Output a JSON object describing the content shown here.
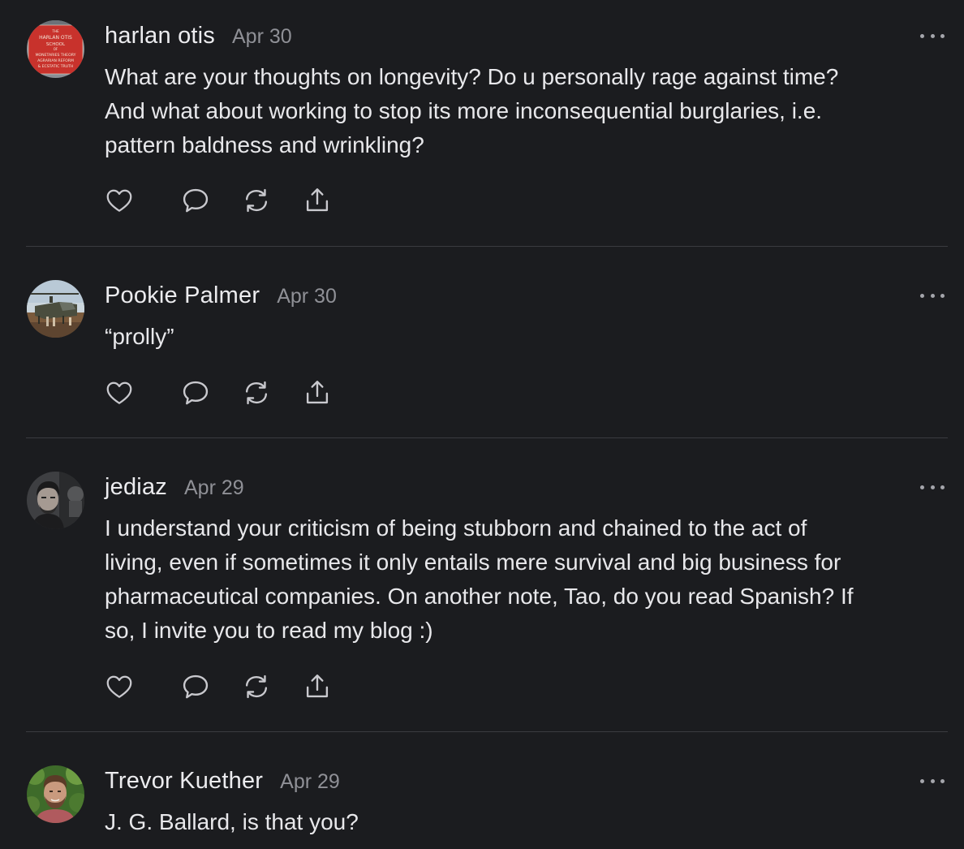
{
  "comments": [
    {
      "author": "harlan otis",
      "date": "Apr 30",
      "body_lines": [
        "What are your thoughts on longevity? Do u personally rage against time?",
        "And what about working to stop its more inconsequential burglaries, i.e.",
        "pattern baldness and wrinkling?"
      ],
      "avatar_sign_text": [
        "THE",
        "HARLAN OTIS",
        "SCHOOL",
        "OF",
        "MONETARIES THEORY",
        "AGRARIAN REFORM",
        "& ECSTATIC TRUTH"
      ]
    },
    {
      "author": "Pookie Palmer",
      "date": "Apr 30",
      "body_lines": [
        "“prolly”"
      ]
    },
    {
      "author": "jediaz",
      "date": "Apr 29",
      "body_lines": [
        "I understand your criticism of being stubborn and chained to the act of",
        "living, even if sometimes it only entails mere survival and big business for",
        "pharmaceutical companies. On another note, Tao, do you read Spanish? If",
        "so, I invite you to read my blog :)"
      ]
    },
    {
      "author": "Trevor Kuether",
      "date": "Apr 29",
      "body_lines": [
        "J. G. Ballard, is that you?"
      ]
    }
  ],
  "icons": {
    "like": "heart-icon",
    "reply": "speech-bubble-icon",
    "restack": "restack-arrows-icon",
    "share": "share-upload-icon",
    "more": "more-options-icon"
  },
  "colors": {
    "background": "#1b1c1f",
    "text": "#e8e8eb",
    "muted": "#8f9096",
    "icon": "#c9c9ce",
    "divider": "#3a3b40"
  }
}
